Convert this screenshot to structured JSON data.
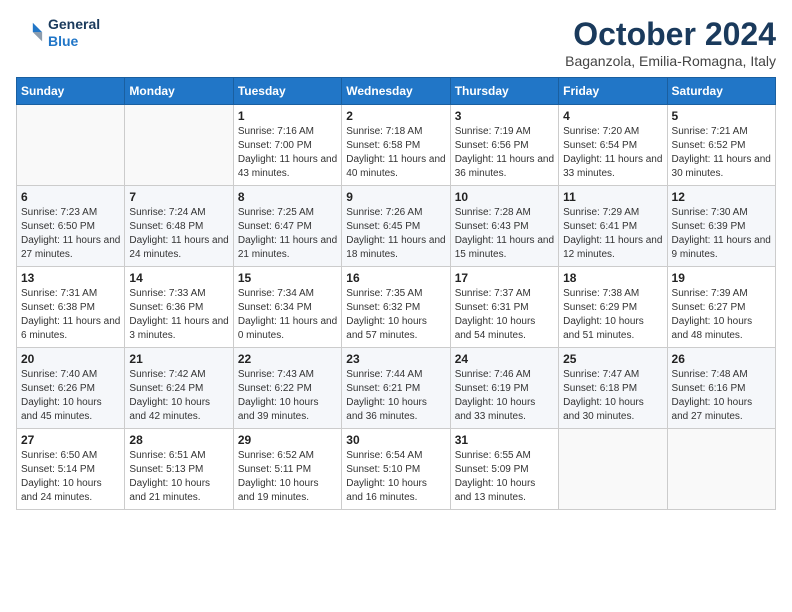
{
  "logo": {
    "line1": "General",
    "line2": "Blue"
  },
  "title": "October 2024",
  "location": "Baganzola, Emilia-Romagna, Italy",
  "weekdays": [
    "Sunday",
    "Monday",
    "Tuesday",
    "Wednesday",
    "Thursday",
    "Friday",
    "Saturday"
  ],
  "weeks": [
    [
      {
        "day": "",
        "info": ""
      },
      {
        "day": "",
        "info": ""
      },
      {
        "day": "1",
        "info": "Sunrise: 7:16 AM\nSunset: 7:00 PM\nDaylight: 11 hours and 43 minutes."
      },
      {
        "day": "2",
        "info": "Sunrise: 7:18 AM\nSunset: 6:58 PM\nDaylight: 11 hours and 40 minutes."
      },
      {
        "day": "3",
        "info": "Sunrise: 7:19 AM\nSunset: 6:56 PM\nDaylight: 11 hours and 36 minutes."
      },
      {
        "day": "4",
        "info": "Sunrise: 7:20 AM\nSunset: 6:54 PM\nDaylight: 11 hours and 33 minutes."
      },
      {
        "day": "5",
        "info": "Sunrise: 7:21 AM\nSunset: 6:52 PM\nDaylight: 11 hours and 30 minutes."
      }
    ],
    [
      {
        "day": "6",
        "info": "Sunrise: 7:23 AM\nSunset: 6:50 PM\nDaylight: 11 hours and 27 minutes."
      },
      {
        "day": "7",
        "info": "Sunrise: 7:24 AM\nSunset: 6:48 PM\nDaylight: 11 hours and 24 minutes."
      },
      {
        "day": "8",
        "info": "Sunrise: 7:25 AM\nSunset: 6:47 PM\nDaylight: 11 hours and 21 minutes."
      },
      {
        "day": "9",
        "info": "Sunrise: 7:26 AM\nSunset: 6:45 PM\nDaylight: 11 hours and 18 minutes."
      },
      {
        "day": "10",
        "info": "Sunrise: 7:28 AM\nSunset: 6:43 PM\nDaylight: 11 hours and 15 minutes."
      },
      {
        "day": "11",
        "info": "Sunrise: 7:29 AM\nSunset: 6:41 PM\nDaylight: 11 hours and 12 minutes."
      },
      {
        "day": "12",
        "info": "Sunrise: 7:30 AM\nSunset: 6:39 PM\nDaylight: 11 hours and 9 minutes."
      }
    ],
    [
      {
        "day": "13",
        "info": "Sunrise: 7:31 AM\nSunset: 6:38 PM\nDaylight: 11 hours and 6 minutes."
      },
      {
        "day": "14",
        "info": "Sunrise: 7:33 AM\nSunset: 6:36 PM\nDaylight: 11 hours and 3 minutes."
      },
      {
        "day": "15",
        "info": "Sunrise: 7:34 AM\nSunset: 6:34 PM\nDaylight: 11 hours and 0 minutes."
      },
      {
        "day": "16",
        "info": "Sunrise: 7:35 AM\nSunset: 6:32 PM\nDaylight: 10 hours and 57 minutes."
      },
      {
        "day": "17",
        "info": "Sunrise: 7:37 AM\nSunset: 6:31 PM\nDaylight: 10 hours and 54 minutes."
      },
      {
        "day": "18",
        "info": "Sunrise: 7:38 AM\nSunset: 6:29 PM\nDaylight: 10 hours and 51 minutes."
      },
      {
        "day": "19",
        "info": "Sunrise: 7:39 AM\nSunset: 6:27 PM\nDaylight: 10 hours and 48 minutes."
      }
    ],
    [
      {
        "day": "20",
        "info": "Sunrise: 7:40 AM\nSunset: 6:26 PM\nDaylight: 10 hours and 45 minutes."
      },
      {
        "day": "21",
        "info": "Sunrise: 7:42 AM\nSunset: 6:24 PM\nDaylight: 10 hours and 42 minutes."
      },
      {
        "day": "22",
        "info": "Sunrise: 7:43 AM\nSunset: 6:22 PM\nDaylight: 10 hours and 39 minutes."
      },
      {
        "day": "23",
        "info": "Sunrise: 7:44 AM\nSunset: 6:21 PM\nDaylight: 10 hours and 36 minutes."
      },
      {
        "day": "24",
        "info": "Sunrise: 7:46 AM\nSunset: 6:19 PM\nDaylight: 10 hours and 33 minutes."
      },
      {
        "day": "25",
        "info": "Sunrise: 7:47 AM\nSunset: 6:18 PM\nDaylight: 10 hours and 30 minutes."
      },
      {
        "day": "26",
        "info": "Sunrise: 7:48 AM\nSunset: 6:16 PM\nDaylight: 10 hours and 27 minutes."
      }
    ],
    [
      {
        "day": "27",
        "info": "Sunrise: 6:50 AM\nSunset: 5:14 PM\nDaylight: 10 hours and 24 minutes."
      },
      {
        "day": "28",
        "info": "Sunrise: 6:51 AM\nSunset: 5:13 PM\nDaylight: 10 hours and 21 minutes."
      },
      {
        "day": "29",
        "info": "Sunrise: 6:52 AM\nSunset: 5:11 PM\nDaylight: 10 hours and 19 minutes."
      },
      {
        "day": "30",
        "info": "Sunrise: 6:54 AM\nSunset: 5:10 PM\nDaylight: 10 hours and 16 minutes."
      },
      {
        "day": "31",
        "info": "Sunrise: 6:55 AM\nSunset: 5:09 PM\nDaylight: 10 hours and 13 minutes."
      },
      {
        "day": "",
        "info": ""
      },
      {
        "day": "",
        "info": ""
      }
    ]
  ]
}
